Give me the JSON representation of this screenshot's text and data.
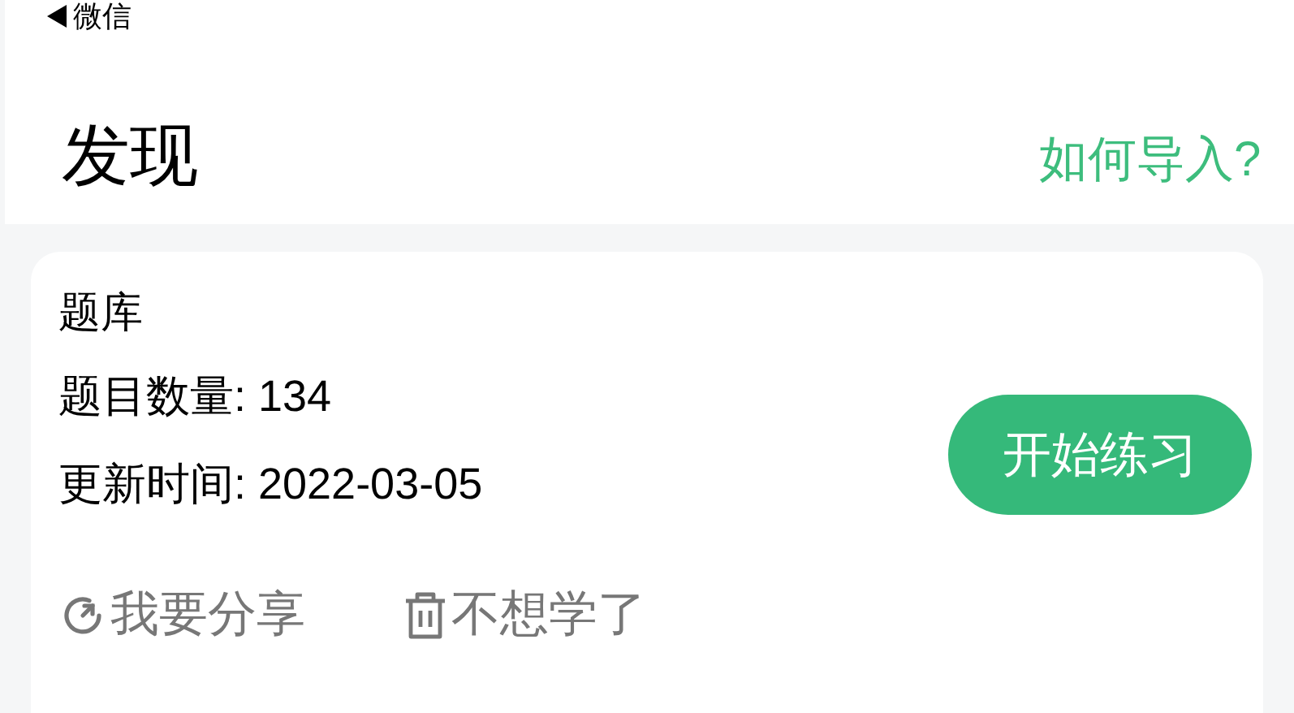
{
  "nav": {
    "back_label": "微信"
  },
  "header": {
    "title": "发现",
    "help_link": "如何导入?"
  },
  "card": {
    "title": "题库",
    "details": [
      "题目数量: 134",
      "更新时间: 2022-03-05"
    ],
    "start_button": "开始练习",
    "actions": [
      {
        "kind": "share",
        "label": "我要分享"
      },
      {
        "kind": "delete",
        "label": "不想学了"
      }
    ]
  }
}
